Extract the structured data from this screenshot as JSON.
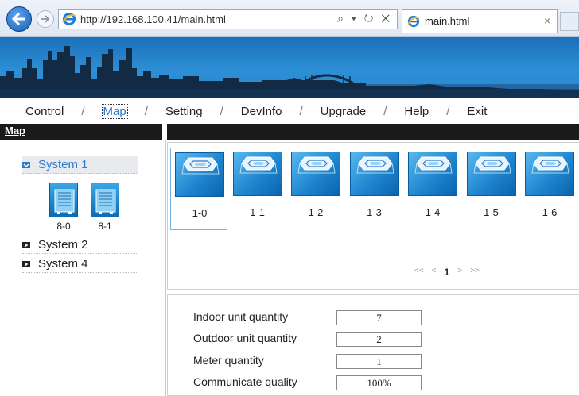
{
  "browser": {
    "url": "http://192.168.100.41/main.html",
    "tab_title": "main.html",
    "address_tools": "⌕ ▾ ↻ ✕",
    "tab_close": "×"
  },
  "nav": {
    "items": [
      "Control",
      "Map",
      "Setting",
      "DevInfo",
      "Upgrade",
      "Help",
      "Exit"
    ],
    "separator": "/",
    "active": "Map"
  },
  "section_title": "Map",
  "tree": {
    "systems": [
      {
        "label": "System 1",
        "expanded": true,
        "selected": true
      },
      {
        "label": "System 2",
        "expanded": false
      },
      {
        "label": "System 4",
        "expanded": false
      }
    ],
    "outdoor_units": [
      "8-0",
      "8-1"
    ]
  },
  "indoor_units": [
    "1-0",
    "1-1",
    "1-2",
    "1-3",
    "1-4",
    "1-5",
    "1-6"
  ],
  "pager": {
    "first": "<<",
    "prev": "<",
    "current": "1",
    "next": ">",
    "last": ">>"
  },
  "info": {
    "indoor_label": "Indoor unit quantity",
    "indoor_value": "7",
    "outdoor_label": "Outdoor unit quantity",
    "outdoor_value": "2",
    "meter_label": "Meter quantity",
    "meter_value": "1",
    "comm_label": "Communicate quality",
    "comm_value": "100%"
  },
  "colors": {
    "accent": "#2a7bd0",
    "banner": "#2d8fd6",
    "header_bar": "#1a1a1a"
  }
}
